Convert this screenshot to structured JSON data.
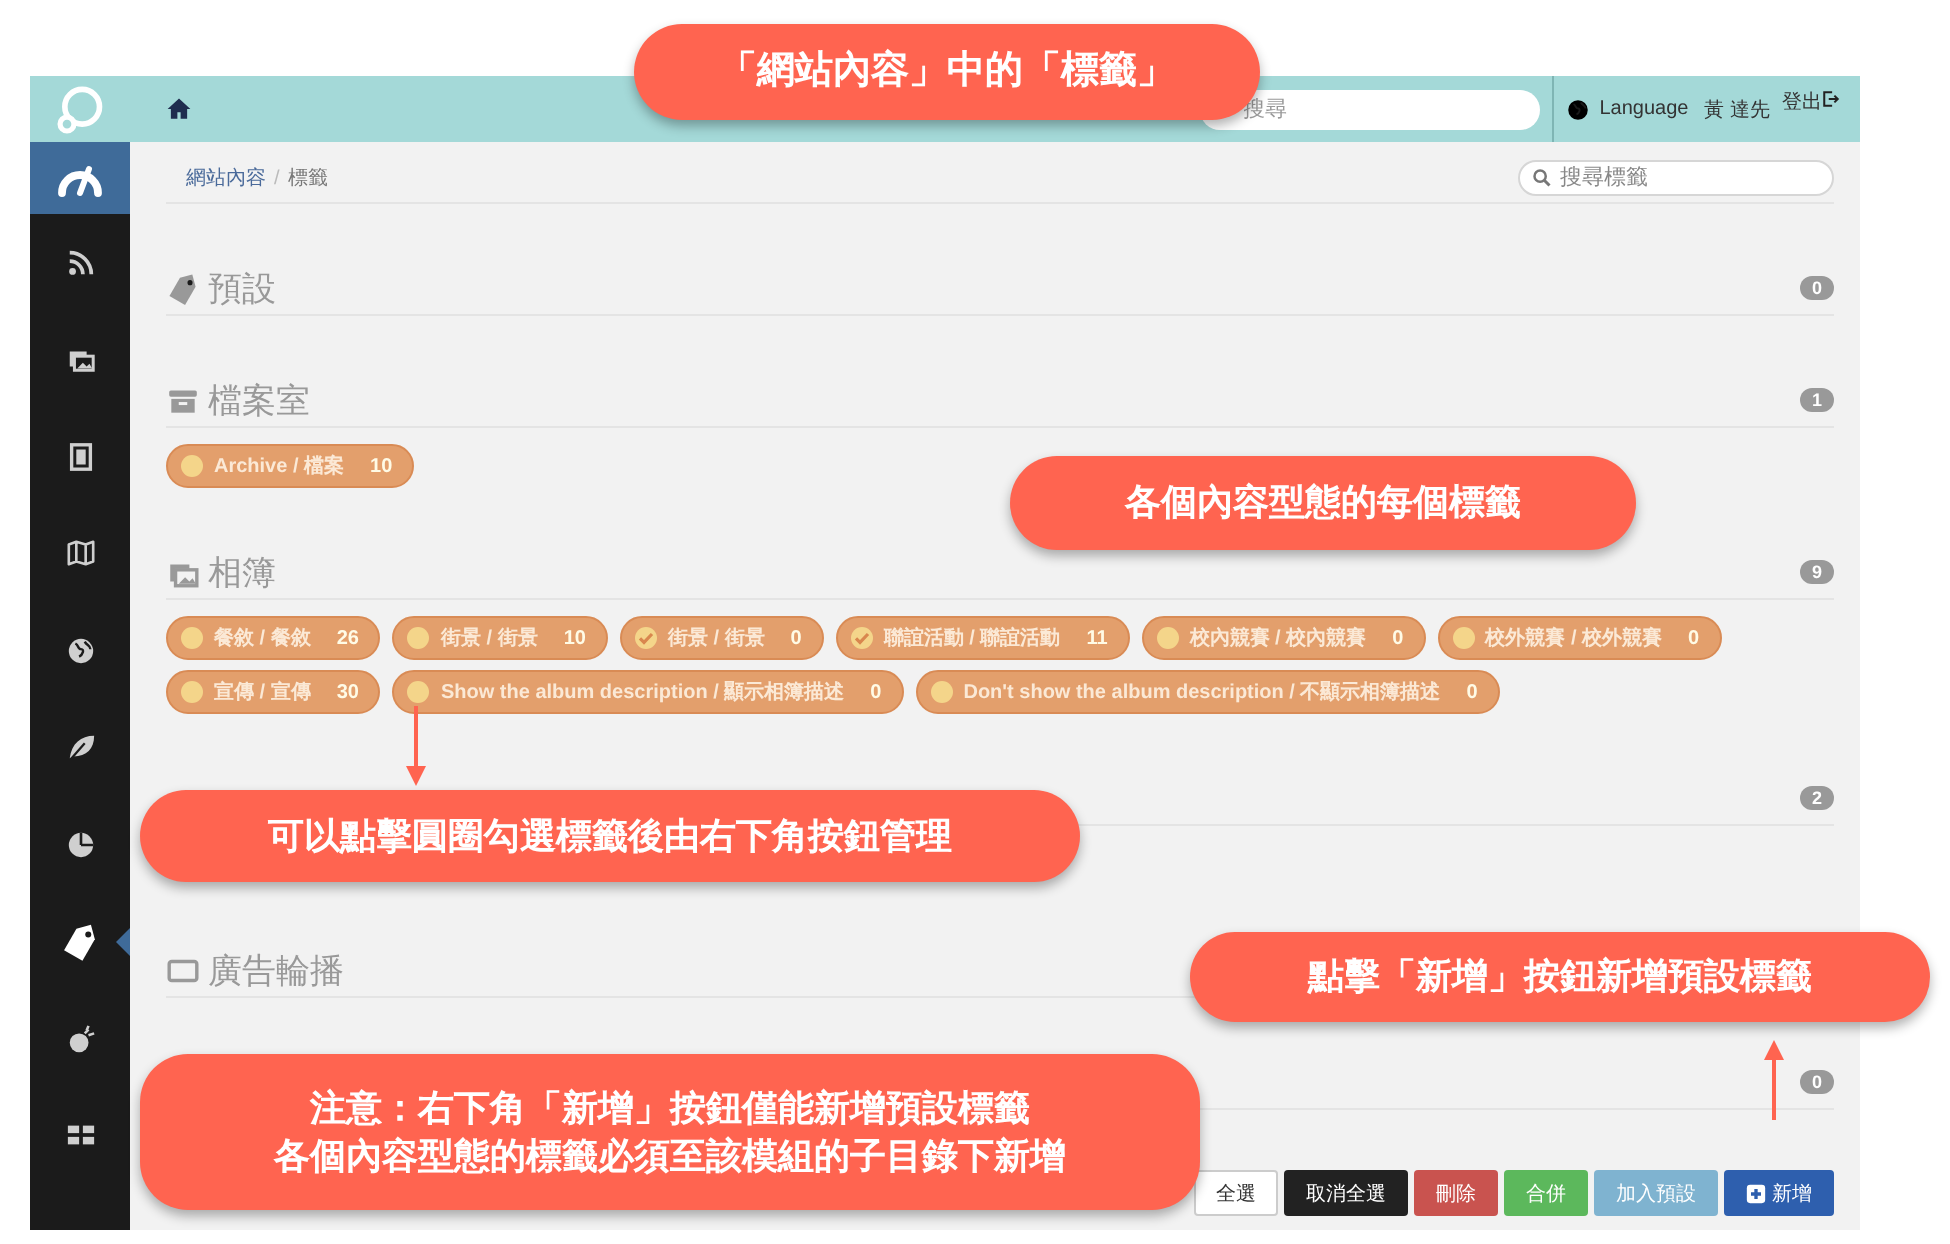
{
  "top_bar": {
    "search": {
      "placeholder": "搜尋"
    },
    "language": "Language",
    "user": "黃 達先",
    "logout": "登出"
  },
  "sidebar": {
    "items": [
      {
        "kind": "dashboard",
        "selected": false
      },
      {
        "kind": "rss",
        "selected": false
      },
      {
        "kind": "photo",
        "selected": false
      },
      {
        "kind": "book",
        "selected": false
      },
      {
        "kind": "map",
        "selected": false
      },
      {
        "kind": "globe",
        "selected": false
      },
      {
        "kind": "leaf",
        "selected": false
      },
      {
        "kind": "pie",
        "selected": false
      },
      {
        "kind": "tag",
        "selected": true
      },
      {
        "kind": "bomb",
        "selected": false
      },
      {
        "kind": "grid",
        "selected": false
      }
    ]
  },
  "breadcrumb": {
    "items": [
      "網站內容",
      "標籤"
    ],
    "separator": "/"
  },
  "tag_search": {
    "placeholder": "搜尋標籤"
  },
  "sections": [
    {
      "kind": "tag",
      "title": "預設",
      "count": "0"
    },
    {
      "kind": "archive",
      "title": "檔案室",
      "count": "1",
      "tags": [
        {
          "label": "Archive / 檔案",
          "count": "10",
          "checked": false
        }
      ]
    },
    {
      "kind": "photo",
      "title": "相簿",
      "count": "9",
      "tags": [
        {
          "label": "餐敘 / 餐敘",
          "count": "26",
          "checked": false
        },
        {
          "label": "街景 / 街景",
          "count": "10",
          "checked": false
        },
        {
          "label": "街景 / 街景",
          "count": "0",
          "checked": true
        },
        {
          "label": "聯誼活動 / 聯誼活動",
          "count": "11",
          "checked": true
        },
        {
          "label": "校內競賽 / 校內競賽",
          "count": "0",
          "checked": false
        },
        {
          "label": "校外競賽 / 校外競賽",
          "count": "0",
          "checked": false
        },
        {
          "label": "宣傳 / 宣傳",
          "count": "30",
          "checked": false
        },
        {
          "label": "Show the album description / 顯示相簿描述",
          "count": "0",
          "checked": false
        },
        {
          "label": "Don't show the album description / 不顯示相簿描述",
          "count": "0",
          "checked": false
        }
      ]
    },
    {
      "count": "2"
    },
    {
      "kind": "slideshow",
      "title": "廣告輪播"
    },
    {
      "count": "0"
    }
  ],
  "buttons": [
    {
      "kind": "select_all",
      "label": "全選"
    },
    {
      "kind": "deselect",
      "label": "取消全選"
    },
    {
      "kind": "delete",
      "label": "刪除"
    },
    {
      "kind": "merge",
      "label": "合併"
    },
    {
      "kind": "add_default",
      "label": "加入預設"
    },
    {
      "kind": "new",
      "label": "新增"
    }
  ],
  "callouts": [
    {
      "kind": "plain",
      "lines": [
        "「網站內容」中的「標籤」"
      ]
    },
    {
      "kind": "plain",
      "lines": [
        "各個內容型態的每個標籤"
      ]
    },
    {
      "kind": "arrow_down",
      "lines": [
        "可以點擊圓圈勾選標籤後由右下角按鈕管理"
      ]
    },
    {
      "kind": "arrow_up",
      "lines": [
        "點擊「新增」按鈕新增預設標籤"
      ]
    },
    {
      "kind": "plain",
      "lines": [
        "注意：右下角「新增」按鈕僅能新增預設標籤",
        "各個內容型態的標籤必須至該模組的子目錄下新增"
      ]
    }
  ]
}
